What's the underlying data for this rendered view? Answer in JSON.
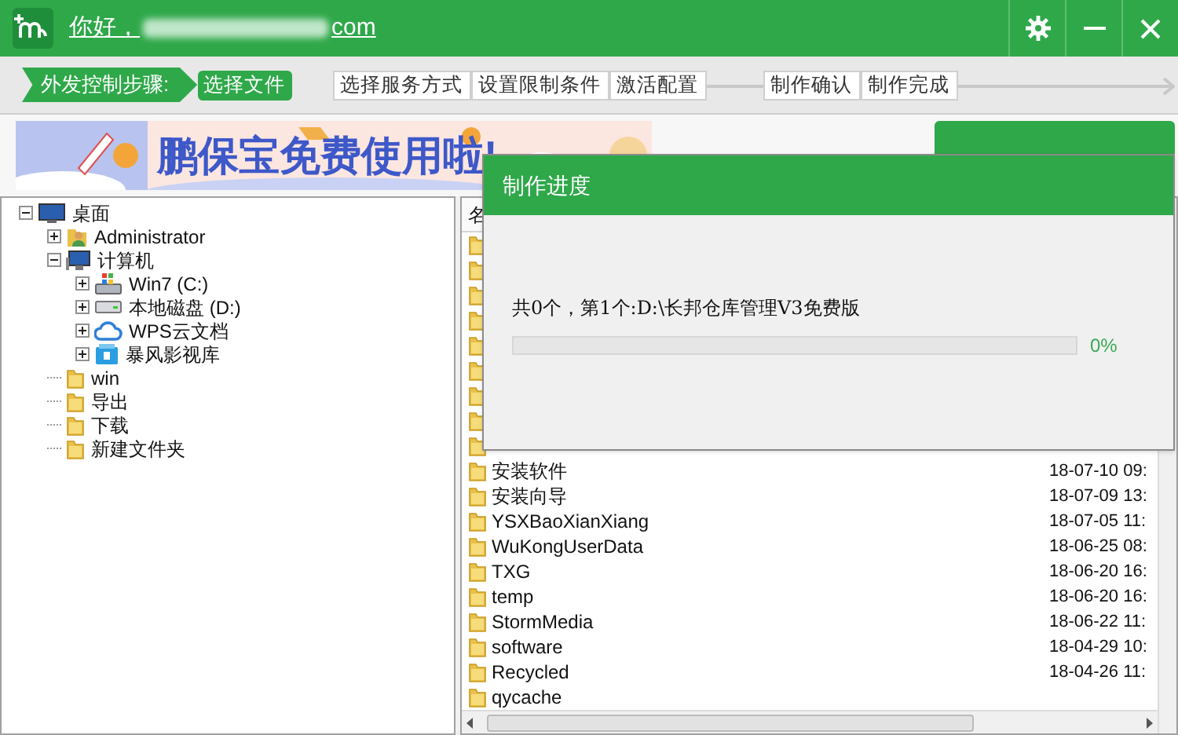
{
  "title_bar": {
    "greeting": "你好，",
    "account_end": "com"
  },
  "steps": {
    "label": "外发控制步骤:",
    "items": [
      {
        "label": "选择文件",
        "selected": true
      },
      {
        "label": "选择服务方式",
        "selected": false
      },
      {
        "label": "设置限制条件",
        "selected": false
      },
      {
        "label": "激活配置",
        "selected": false
      },
      {
        "label": "制作确认",
        "selected": false
      },
      {
        "label": "制作完成",
        "selected": false
      }
    ]
  },
  "banner": {
    "text": "鹏保宝免费使用啦!"
  },
  "tree": [
    {
      "label": "桌面",
      "kind": "desktop",
      "expanded": true,
      "children": [
        {
          "label": "Administrator",
          "kind": "user",
          "expanded": false
        },
        {
          "label": "计算机",
          "kind": "computer",
          "expanded": true,
          "children": [
            {
              "label": "Win7 (C:)",
              "kind": "system-drive",
              "expanded": false
            },
            {
              "label": "本地磁盘 (D:)",
              "kind": "drive",
              "expanded": false
            },
            {
              "label": "WPS云文档",
              "kind": "cloud",
              "expanded": false
            },
            {
              "label": "暴风影视库",
              "kind": "library",
              "expanded": false
            }
          ]
        },
        {
          "label": "win",
          "kind": "folder"
        },
        {
          "label": "导出",
          "kind": "folder"
        },
        {
          "label": "下载",
          "kind": "folder"
        },
        {
          "label": "新建文件夹",
          "kind": "folder"
        }
      ]
    }
  ],
  "file_list": {
    "columns": [
      "名"
    ],
    "rows": [
      {
        "name": "安装软件",
        "date": "18-07-10 09:"
      },
      {
        "name": "安装向导",
        "date": "18-07-09 13:"
      },
      {
        "name": "YSXBaoXianXiang",
        "date": "18-07-05 11:"
      },
      {
        "name": "WuKongUserData",
        "date": "18-06-25 08:"
      },
      {
        "name": "TXG",
        "date": "18-06-20 16:"
      },
      {
        "name": "temp",
        "date": "18-06-20 16:"
      },
      {
        "name": "StormMedia",
        "date": "18-06-22 11:"
      },
      {
        "name": "software",
        "date": "18-04-29 10:"
      },
      {
        "name": "Recycled",
        "date": "18-04-26 11:"
      },
      {
        "name": "qycache"
      }
    ]
  },
  "progress_dialog": {
    "title": "制作进度",
    "message": "共0个，第1个:D:\\长邦仓库管理V3免费版",
    "level": 0,
    "percent": "0%"
  }
}
